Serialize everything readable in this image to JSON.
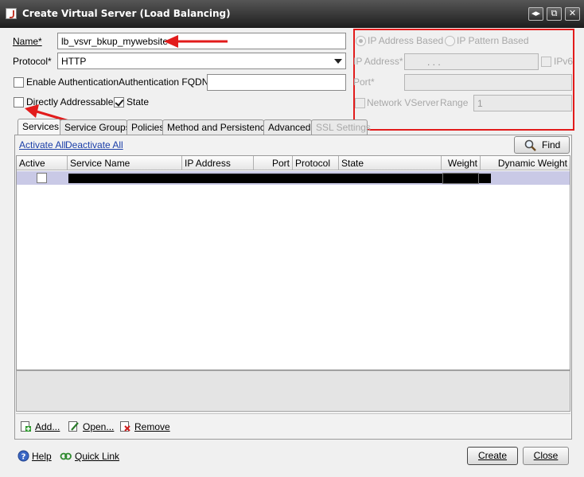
{
  "window": {
    "title": "Create Virtual Server (Load Balancing)",
    "buttons": [
      "◂▸",
      "⧉",
      "✕"
    ]
  },
  "form": {
    "name_label": "Name*",
    "name_value": "lb_vsvr_bkup_mywebsite",
    "protocol_label": "Protocol*",
    "protocol_value": "HTTP",
    "enable_auth_label": "Enable Authentication",
    "enable_auth_checked": false,
    "auth_fqdn_label": "Authentication FQDN",
    "auth_fqdn_value": "",
    "directly_addressable_label": "Directly Addressable",
    "directly_addressable_checked": false,
    "state_label": "State",
    "state_checked": true
  },
  "address_panel": {
    "ip_based_label": "IP Address Based",
    "ip_pattern_label": "IP Pattern Based",
    "ip_address_label": "IP Address*",
    "ip_address_value": ".       .       .",
    "ipv6_label": "IPv6",
    "port_label": "Port*",
    "port_value": "",
    "network_vserver_label": "Network VServer",
    "range_label": "Range",
    "range_value": "1"
  },
  "tabs": [
    {
      "label": "Services",
      "active": true,
      "disabled": false
    },
    {
      "label": "Service Groups",
      "active": false,
      "disabled": false
    },
    {
      "label": "Policies",
      "active": false,
      "disabled": false
    },
    {
      "label": "Method and Persistence",
      "active": false,
      "disabled": false
    },
    {
      "label": "Advanced",
      "active": false,
      "disabled": false
    },
    {
      "label": "SSL Settings",
      "active": false,
      "disabled": true
    }
  ],
  "services": {
    "activate_all": "Activate All",
    "deactivate_all": "Deactivate All",
    "find_button": "Find",
    "columns": [
      "Active",
      "Service Name",
      "IP Address",
      "Port",
      "Protocol",
      "State",
      "Weight",
      "Dynamic Weight"
    ],
    "rows": [
      {
        "active": false,
        "service_name": "",
        "ip_address": "",
        "port": "",
        "protocol": "",
        "state": "",
        "weight": "",
        "dynamic_weight": ""
      }
    ],
    "add_button": "Add...",
    "open_button": "Open...",
    "remove_button": "Remove"
  },
  "footer": {
    "help_label": "Help",
    "quick_link_label": "Quick Link",
    "create_button": "Create",
    "close_button": "Close"
  },
  "colors": {
    "annotation_red": "#e21b1b",
    "selected_row": "#c9c9e6",
    "link_blue": "#1a3ea8"
  }
}
